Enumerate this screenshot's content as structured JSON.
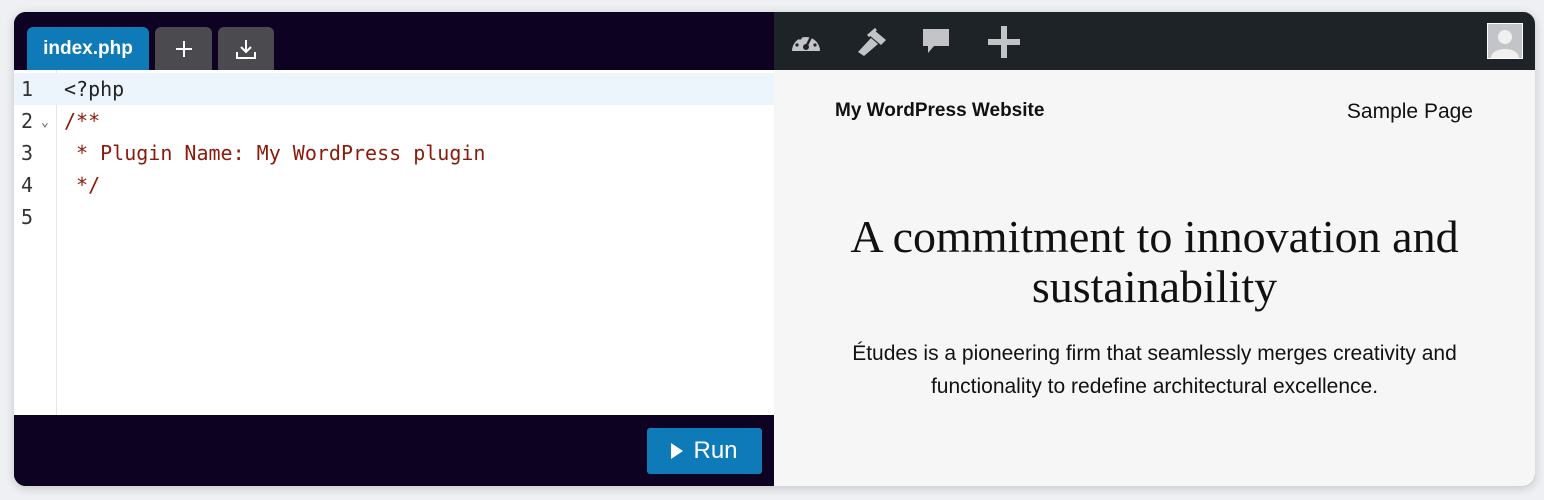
{
  "editor": {
    "tabs": {
      "file_label": "index.php",
      "new_icon": "plus-icon",
      "download_icon": "download-icon"
    },
    "lines": [
      {
        "number": "1",
        "text": "<?php"
      },
      {
        "number": "2",
        "text": "/**"
      },
      {
        "number": "3",
        "text": " * Plugin Name: My WordPress plugin"
      },
      {
        "number": "4",
        "text": " */"
      },
      {
        "number": "5",
        "text": ""
      }
    ],
    "run_label": "Run"
  },
  "preview": {
    "adminbar_icons": [
      "dashboard-icon",
      "customize-brush-icon",
      "comment-icon",
      "add-new-icon",
      "avatar-icon"
    ],
    "site_title": "My WordPress Website",
    "nav_link": "Sample Page",
    "hero_title": "A commitment to innovation and sustainability",
    "hero_text": "Études is a pioneering firm that seamlessly merges creativity and functionality to redefine architectural excellence."
  },
  "colors": {
    "editor_bg": "#0d0221",
    "accent_blue": "#0f7ab8",
    "admin_bar": "#1d2327",
    "comment_red": "#8b1a0b"
  }
}
